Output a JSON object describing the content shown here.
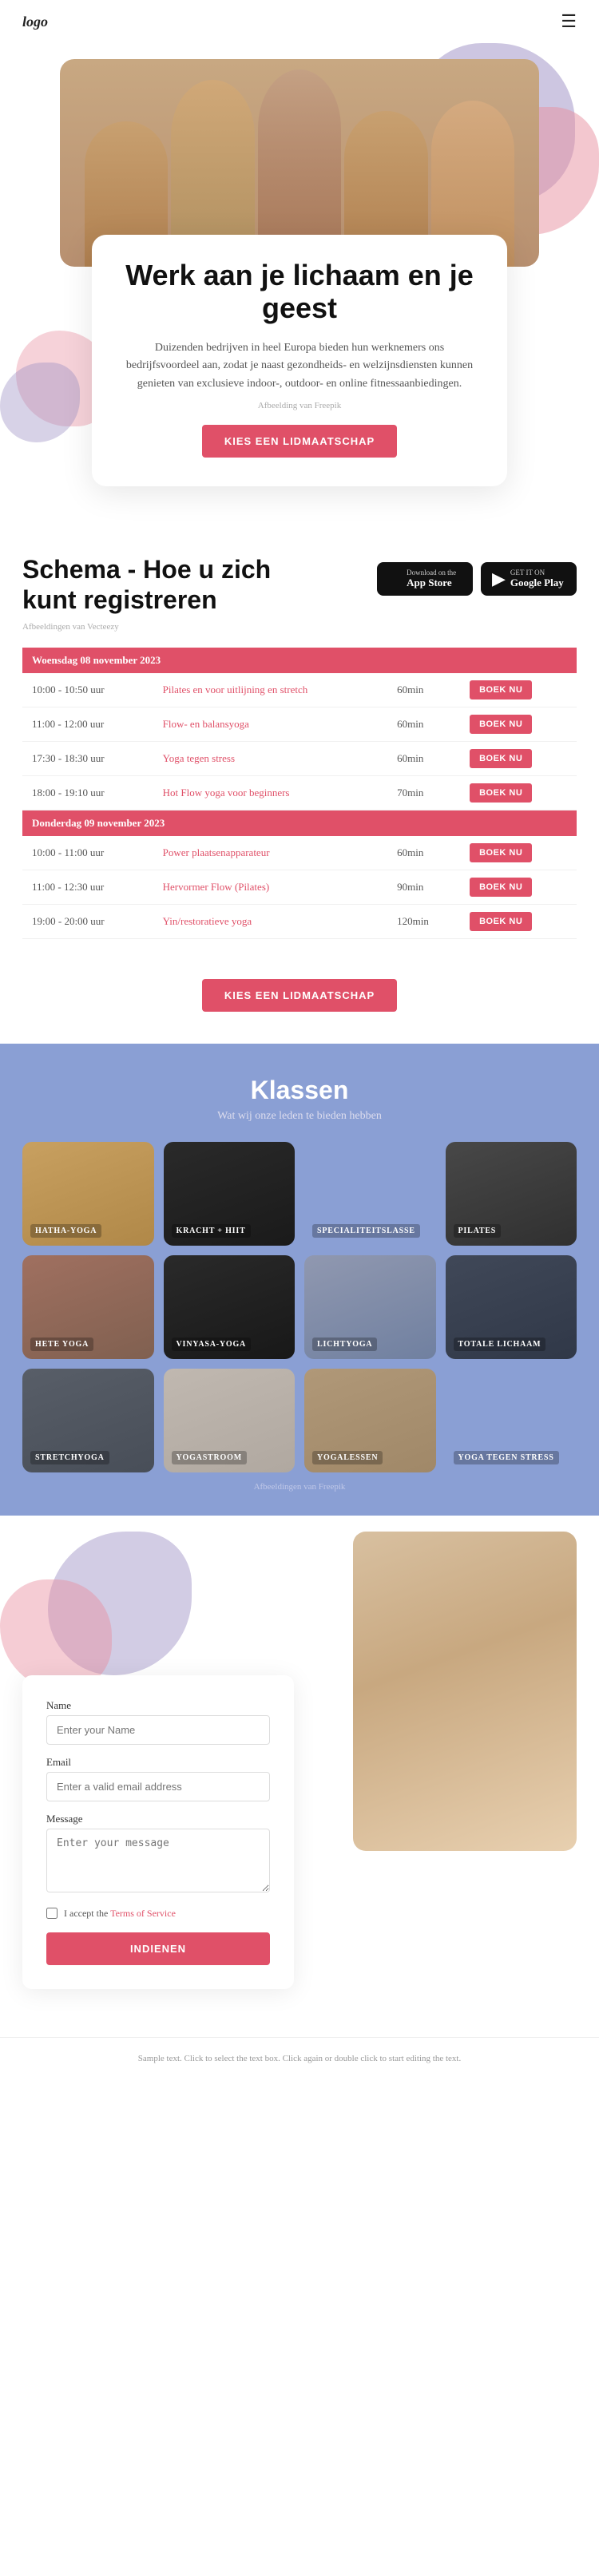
{
  "header": {
    "logo": "logo",
    "menu_icon": "☰"
  },
  "hero": {
    "title": "Werk aan je lichaam en je geest",
    "description": "Duizenden bedrijven in heel Europa bieden hun werknemers ons bedrijfsvoordeel aan, zodat je naast gezondheids- en welzijnsdiensten kunnen genieten van exclusieve indoor-, outdoor- en online fitnessaanbiedingen.",
    "credit": "Afbeelding van Freepik",
    "cta_button": "KIES EEN LIDMAATSCHAP"
  },
  "schedule": {
    "title": "Schema - Hoe u zich kunt registreren",
    "credit": "Afbeeldingen van Vecteezy",
    "app_store": {
      "small": "Download on the",
      "large": "App Store"
    },
    "google_play": {
      "small": "GET IT ON",
      "large": "Google Play"
    },
    "days": [
      {
        "label": "Woensdag 08 november 2023",
        "classes": [
          {
            "time": "10:00 - 10:50 uur",
            "name": "Pilates en voor uitlijning en stretch",
            "duration": "60min",
            "book": "BOEK NU"
          },
          {
            "time": "11:00 - 12:00 uur",
            "name": "Flow- en balansyoga",
            "duration": "60min",
            "book": "BOEK NU"
          },
          {
            "time": "17:30 - 18:30 uur",
            "name": "Yoga tegen stress",
            "duration": "60min",
            "book": "BOEK NU"
          },
          {
            "time": "18:00 - 19:10 uur",
            "name": "Hot Flow yoga voor beginners",
            "duration": "70min",
            "book": "BOEK NU"
          }
        ]
      },
      {
        "label": "Donderdag 09 november 2023",
        "classes": [
          {
            "time": "10:00 - 11:00 uur",
            "name": "Power plaatsenapparateur",
            "duration": "60min",
            "book": "BOEK NU"
          },
          {
            "time": "11:00 - 12:30 uur",
            "name": "Hervormer Flow (Pilates)",
            "duration": "90min",
            "book": "BOEK NU"
          },
          {
            "time": "19:00 - 20:00 uur",
            "name": "Yin/restoratieve yoga",
            "duration": "120min",
            "book": "BOEK NU"
          }
        ]
      }
    ],
    "cta_button": "KIES EEN LIDMAATSCHAP"
  },
  "classes": {
    "title": "Klassen",
    "subtitle": "Wat wij onze leden te bieden hebben",
    "credit": "Afbeeldingen van Freepik",
    "items": [
      {
        "label": "HATHA-YOGA",
        "color1": "#c8a870",
        "color2": "#a08050"
      },
      {
        "label": "KRACHT + HIIT",
        "color1": "#3a3a3a",
        "color2": "#222"
      },
      {
        "label": "SPECIALITEITSLASSE",
        "color1": "#8090b0",
        "color2": "#607090"
      },
      {
        "label": "PILATES",
        "color1": "#505050",
        "color2": "#383838"
      },
      {
        "label": "HETE YOGA",
        "color1": "#b08060",
        "color2": "#906040"
      },
      {
        "label": "VINYASA-YOGA",
        "color1": "#3a3a3a",
        "color2": "#222"
      },
      {
        "label": "LICHTYOGA",
        "color1": "#a0b0c8",
        "color2": "#8090a8"
      },
      {
        "label": "TOTALE LICHAAM",
        "color1": "#4a5060",
        "color2": "#3a4050"
      },
      {
        "label": "STRETCHYOGA",
        "color1": "#606870",
        "color2": "#505860"
      },
      {
        "label": "YOGASTROOM",
        "color1": "#d0c8c0",
        "color2": "#c0b8b0"
      },
      {
        "label": "YOGALESSEN",
        "color1": "#c0a890",
        "color2": "#a09070"
      },
      {
        "label": "YOGA TEGEN STRESS",
        "color1": "#a0b0c0",
        "color2": "#8090a0"
      }
    ]
  },
  "contact": {
    "form": {
      "name_label": "Name",
      "name_placeholder": "Enter your Name",
      "email_label": "Email",
      "email_placeholder": "Enter a valid email address",
      "message_label": "Message",
      "message_placeholder": "Enter your message",
      "checkbox_text": "I accept the",
      "checkbox_link": "Terms of Service",
      "submit_button": "INDIENEN"
    },
    "sample_text": "Sample text. Click to select the text box. Click again or double click to start editing the text."
  }
}
